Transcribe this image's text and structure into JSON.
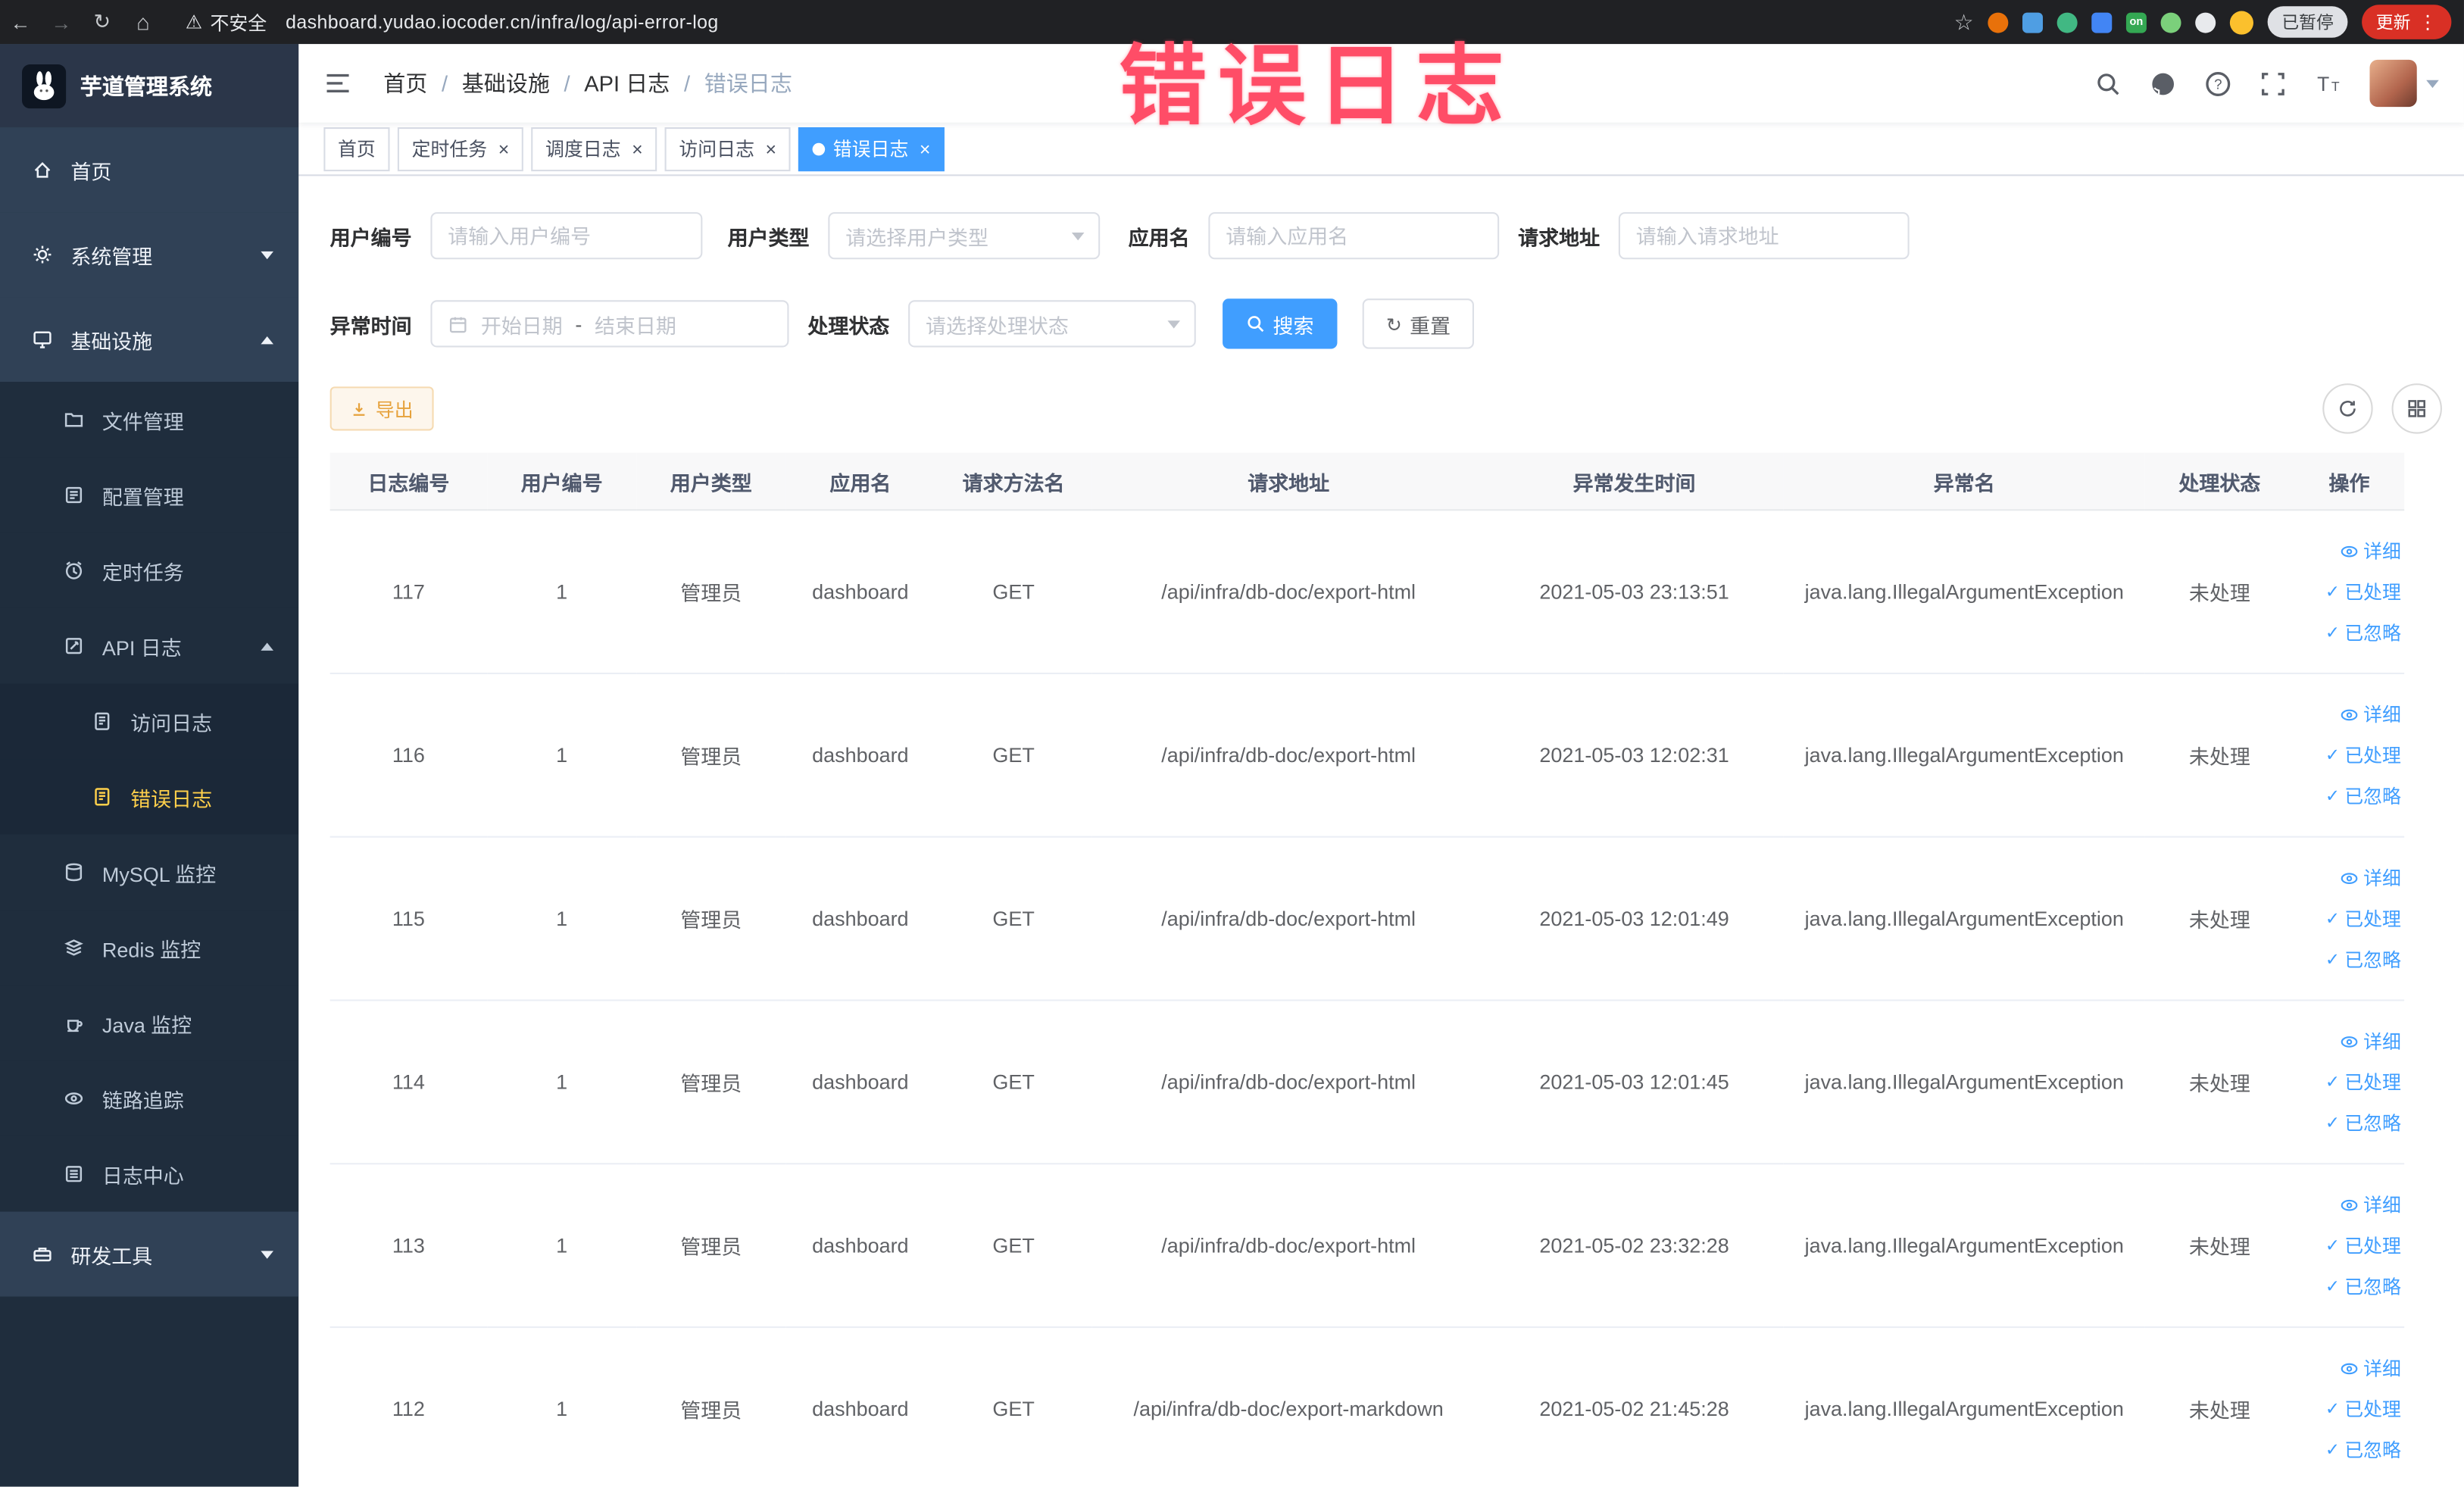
{
  "annotation": {
    "text": "错误日志"
  },
  "colors": {
    "accent": "#409eff",
    "sidebar_active": "#ffd04b",
    "warning_button": "#e6a23c",
    "annotation": "#ff4d67",
    "update_button": "#d93025"
  },
  "browser": {
    "security_label": "不安全",
    "url": "dashboard.yudao.iocoder.cn/infra/log/api-error-log",
    "paused_badge": "已暂停",
    "update_label": "更新",
    "extension_on_badge": "on"
  },
  "sidebar": {
    "logo_title": "芋道管理系统",
    "items": [
      {
        "label": "首页"
      },
      {
        "label": "系统管理"
      },
      {
        "label": "基础设施"
      },
      {
        "label": "文件管理"
      },
      {
        "label": "配置管理"
      },
      {
        "label": "定时任务"
      },
      {
        "label": "API 日志"
      },
      {
        "label": "访问日志"
      },
      {
        "label": "错误日志"
      },
      {
        "label": "MySQL 监控"
      },
      {
        "label": "Redis 监控"
      },
      {
        "label": "Java 监控"
      },
      {
        "label": "链路追踪"
      },
      {
        "label": "日志中心"
      },
      {
        "label": "研发工具"
      }
    ]
  },
  "header": {
    "breadcrumb": [
      {
        "label": "首页"
      },
      {
        "label": "基础设施"
      },
      {
        "label": "API 日志"
      },
      {
        "label": "错误日志"
      }
    ]
  },
  "tabs": [
    {
      "label": "首页"
    },
    {
      "label": "定时任务"
    },
    {
      "label": "调度日志"
    },
    {
      "label": "访问日志"
    },
    {
      "label": "错误日志"
    }
  ],
  "filters": {
    "user_id_label": "用户编号",
    "user_id_placeholder": "请输入用户编号",
    "user_type_label": "用户类型",
    "user_type_placeholder": "请选择用户类型",
    "app_name_label": "应用名",
    "app_name_placeholder": "请输入应用名",
    "request_url_label": "请求地址",
    "request_url_placeholder": "请输入请求地址",
    "exception_time_label": "异常时间",
    "date_start_placeholder": "开始日期",
    "date_separator": "-",
    "date_end_placeholder": "结束日期",
    "process_status_label": "处理状态",
    "process_status_placeholder": "请选择处理状态",
    "search_label": "搜索",
    "reset_label": "重置"
  },
  "toolbar": {
    "export_label": "导出"
  },
  "table": {
    "columns": [
      "日志编号",
      "用户编号",
      "用户类型",
      "应用名",
      "请求方法名",
      "请求地址",
      "异常发生时间",
      "异常名",
      "处理状态",
      "操作"
    ],
    "action_labels": {
      "detail": "详细",
      "processed": "已处理",
      "ignored": "已忽略"
    },
    "rows": [
      {
        "id": "117",
        "user_id": "1",
        "user_type": "管理员",
        "app": "dashboard",
        "method": "GET",
        "url": "/api/infra/db-doc/export-html",
        "time": "2021-05-03 23:13:51",
        "exception": "java.lang.IllegalArgumentException",
        "status": "未处理"
      },
      {
        "id": "116",
        "user_id": "1",
        "user_type": "管理员",
        "app": "dashboard",
        "method": "GET",
        "url": "/api/infra/db-doc/export-html",
        "time": "2021-05-03 12:02:31",
        "exception": "java.lang.IllegalArgumentException",
        "status": "未处理"
      },
      {
        "id": "115",
        "user_id": "1",
        "user_type": "管理员",
        "app": "dashboard",
        "method": "GET",
        "url": "/api/infra/db-doc/export-html",
        "time": "2021-05-03 12:01:49",
        "exception": "java.lang.IllegalArgumentException",
        "status": "未处理"
      },
      {
        "id": "114",
        "user_id": "1",
        "user_type": "管理员",
        "app": "dashboard",
        "method": "GET",
        "url": "/api/infra/db-doc/export-html",
        "time": "2021-05-03 12:01:45",
        "exception": "java.lang.IllegalArgumentException",
        "status": "未处理"
      },
      {
        "id": "113",
        "user_id": "1",
        "user_type": "管理员",
        "app": "dashboard",
        "method": "GET",
        "url": "/api/infra/db-doc/export-html",
        "time": "2021-05-02 23:32:28",
        "exception": "java.lang.IllegalArgumentException",
        "status": "未处理"
      },
      {
        "id": "112",
        "user_id": "1",
        "user_type": "管理员",
        "app": "dashboard",
        "method": "GET",
        "url": "/api/infra/db-doc/export-markdown",
        "time": "2021-05-02 21:45:28",
        "exception": "java.lang.IllegalArgumentException",
        "status": "未处理"
      }
    ]
  }
}
